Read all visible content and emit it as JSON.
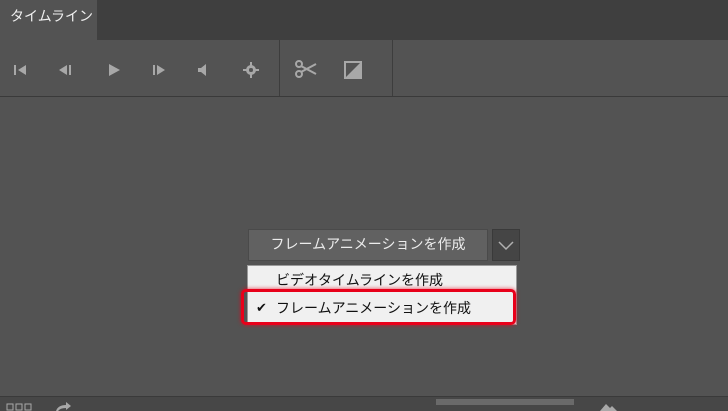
{
  "panel": {
    "tab_label": "タイムライン"
  },
  "toolbar": {
    "icons": [
      "first-frame-icon",
      "previous-frame-icon",
      "play-icon",
      "next-frame-icon",
      "audio-icon",
      "settings-icon",
      "scissors-icon",
      "transition-icon"
    ]
  },
  "create_button": {
    "label": "フレームアニメーションを作成"
  },
  "dropdown_menu": {
    "items": [
      {
        "label": "ビデオタイムラインを作成",
        "checked": false
      },
      {
        "label": "フレームアニメーションを作成",
        "checked": true
      }
    ],
    "check_glyph": "✔"
  },
  "colors": {
    "highlight": "#e8001a",
    "panel_bg": "#535353",
    "menu_bg": "#f0f0f0"
  }
}
